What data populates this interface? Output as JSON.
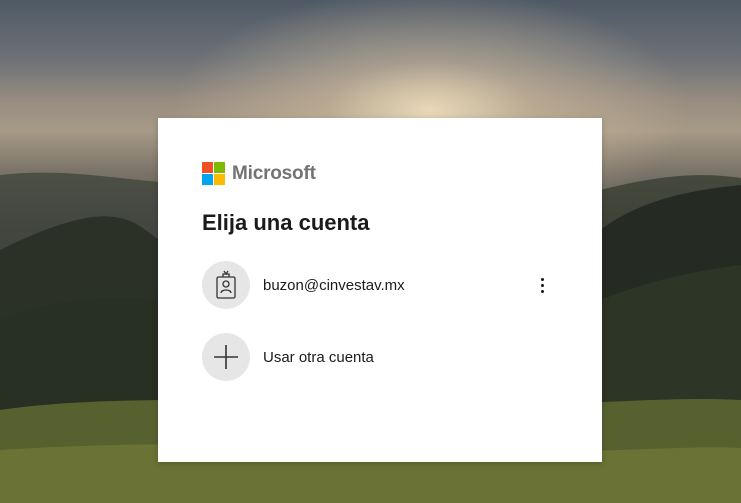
{
  "brand": {
    "name": "Microsoft",
    "logo_colors": [
      "#f25022",
      "#7fba00",
      "#00a4ef",
      "#ffb900"
    ]
  },
  "page": {
    "title": "Elija una cuenta"
  },
  "accounts": [
    {
      "email": "buzon@cinvestav.mx",
      "icon": "work-badge-icon",
      "menu_icon": "more-options-icon"
    }
  ],
  "other_account": {
    "label": "Usar otra cuenta",
    "icon": "plus-icon"
  }
}
